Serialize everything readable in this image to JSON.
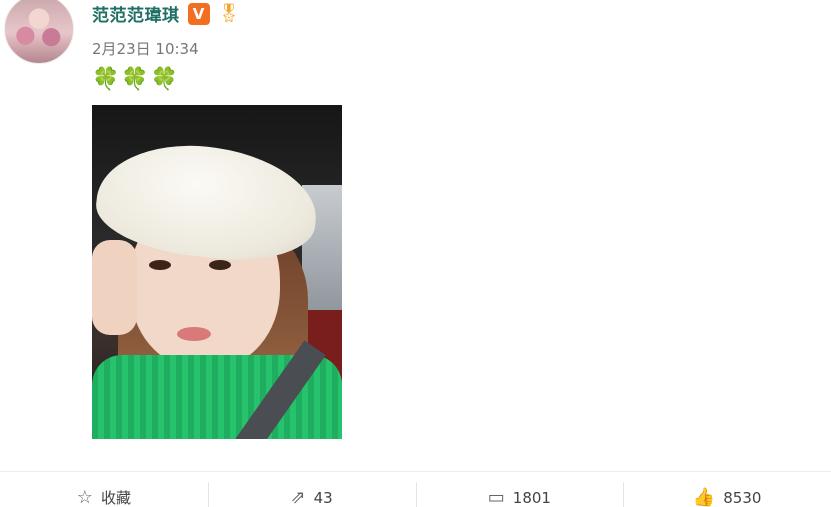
{
  "user": {
    "name": "范范范瑋琪",
    "badge_label": "V",
    "medal_icon": "medal-icon"
  },
  "post": {
    "timestamp": "2月23日 10:34",
    "text": "🍀🍀🍀"
  },
  "actions": {
    "favorite": {
      "icon": "☆",
      "label": "收藏"
    },
    "repost": {
      "icon": "⇗",
      "label": "43"
    },
    "comment": {
      "icon": "▭",
      "label": "1801"
    },
    "like": {
      "icon": "👍",
      "label": "8530"
    }
  },
  "colors": {
    "username": "#1f6f64",
    "badge": "#f26f21",
    "clover": "#2c9a3a"
  }
}
